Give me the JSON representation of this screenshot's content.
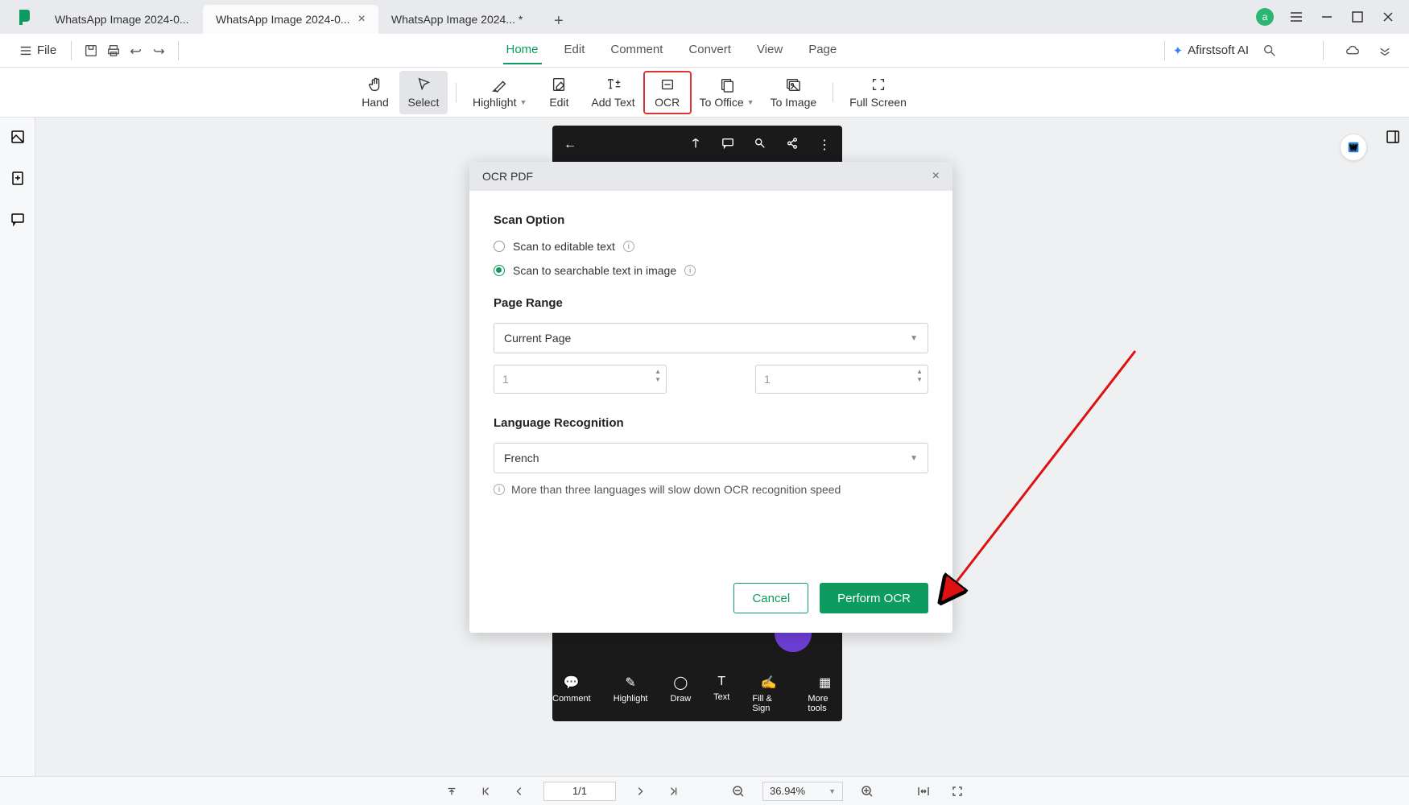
{
  "titlebar": {
    "tabs": [
      {
        "label": "WhatsApp Image 2024-0..."
      },
      {
        "label": "WhatsApp Image 2024-0..."
      },
      {
        "label": "WhatsApp Image 2024... *"
      }
    ],
    "avatar": "a"
  },
  "menubar": {
    "file": "File",
    "tabs": [
      "Home",
      "Edit",
      "Comment",
      "Convert",
      "View",
      "Page"
    ],
    "active_tab": "Home",
    "ai_label": "Afirstsoft AI"
  },
  "toolbar": {
    "hand": "Hand",
    "select": "Select",
    "highlight": "Highlight",
    "edit": "Edit",
    "add_text": "Add Text",
    "ocr": "OCR",
    "to_office": "To Office",
    "to_image": "To Image",
    "full_screen": "Full Screen"
  },
  "doc_preview": {
    "bottom_items": [
      "Comment",
      "Highlight",
      "Draw",
      "Text",
      "Fill & Sign",
      "More tools"
    ]
  },
  "dialog": {
    "title": "OCR PDF",
    "scan_option_heading": "Scan Option",
    "radio1": "Scan to editable text",
    "radio2": "Scan to searchable text in image",
    "page_range_heading": "Page Range",
    "page_range_value": "Current Page",
    "range_from": "1",
    "range_to": "1",
    "language_heading": "Language Recognition",
    "language_value": "French",
    "hint": "More than three languages will slow down OCR recognition speed",
    "cancel": "Cancel",
    "perform": "Perform OCR"
  },
  "statusbar": {
    "page": "1/1",
    "zoom": "36.94%"
  }
}
